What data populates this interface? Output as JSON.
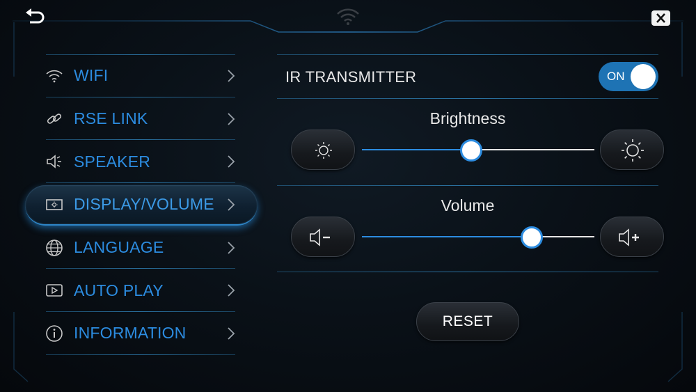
{
  "topbar": {
    "back_icon": "back-arrow-icon",
    "close_icon": "close-icon",
    "status_icon": "wifi-icon"
  },
  "menu": {
    "items": [
      {
        "label": "WIFI",
        "icon": "wifi-icon",
        "active": false
      },
      {
        "label": "RSE LINK",
        "icon": "link-icon",
        "active": false
      },
      {
        "label": "SPEAKER",
        "icon": "speaker-icon",
        "active": false
      },
      {
        "label": "DISPLAY/VOLUME",
        "icon": "display-icon",
        "active": true
      },
      {
        "label": "LANGUAGE",
        "icon": "globe-icon",
        "active": false
      },
      {
        "label": "AUTO PLAY",
        "icon": "play-icon",
        "active": false
      },
      {
        "label": "INFORMATION",
        "icon": "info-icon",
        "active": false
      }
    ]
  },
  "ir": {
    "label": "IR TRANSMITTER",
    "toggle_text": "ON",
    "enabled": true
  },
  "brightness": {
    "title": "Brightness",
    "level": 0.47
  },
  "volume": {
    "title": "Volume",
    "level": 0.73
  },
  "reset_label": "RESET",
  "colors": {
    "accent": "#2c8ce0",
    "toggle_on": "#1e73b4",
    "text": "#e8e8e8"
  }
}
